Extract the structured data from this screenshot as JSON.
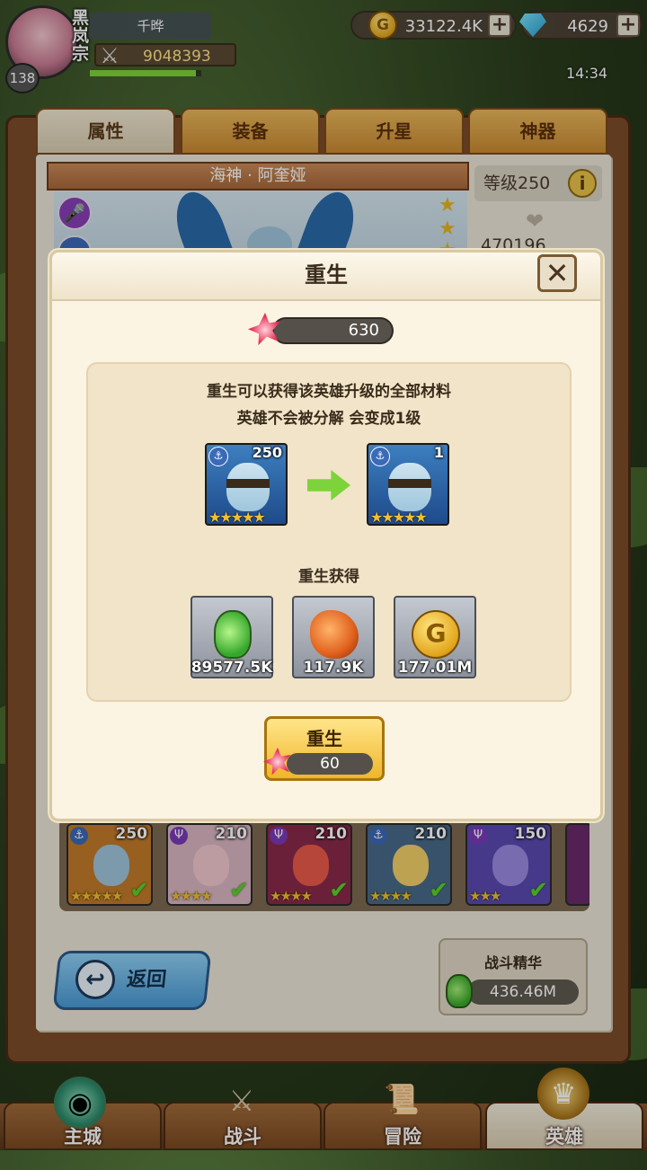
{
  "player": {
    "guild_tag": "黑岚宗",
    "name": "千晔",
    "level": "138",
    "power": "9048393",
    "exp_fraction": 0.95
  },
  "resources": {
    "gold": "33122.4K",
    "gems": "4629"
  },
  "clock": "14:34",
  "tabs": [
    "属性",
    "装备",
    "升星",
    "神器"
  ],
  "hero_panel": {
    "hero_name": "海神 · 阿奎娅",
    "level_label": "等级250",
    "hp": "470196"
  },
  "modal": {
    "title": "重生",
    "cost": "630",
    "description_line1": "重生可以获得该英雄升级的全部材料",
    "description_line2": "英雄不会被分解 会变成1级",
    "before_level": "250",
    "after_level": "1",
    "reward_title": "重生获得",
    "rewards": [
      {
        "icon": "potion-icon",
        "amount": "89577.5K"
      },
      {
        "icon": "ore-icon",
        "amount": "117.9K"
      },
      {
        "icon": "gold-coin-icon",
        "amount": "177.01M"
      }
    ],
    "button_label": "重生",
    "button_cost": "60"
  },
  "roster": [
    {
      "level": "250",
      "stars": 5,
      "class": "anchor",
      "colors": {
        "bg": "#c27a2a",
        "face": "#9fc6dc"
      }
    },
    {
      "level": "210",
      "stars": 4,
      "class": "trident",
      "colors": {
        "bg": "#d9b6c2",
        "face": "#f2c8cf"
      }
    },
    {
      "level": "210",
      "stars": 4,
      "class": "trident",
      "colors": {
        "bg": "#8a2a4a",
        "face": "#e85a4a"
      }
    },
    {
      "level": "210",
      "stars": 4,
      "class": "anchor",
      "colors": {
        "bg": "#4a6a8a",
        "face": "#f2d06a"
      }
    },
    {
      "level": "150",
      "stars": 3,
      "class": "trident",
      "colors": {
        "bg": "#5a4ab0",
        "face": "#9a8ae0"
      }
    }
  ],
  "back_button": "返回",
  "essence": {
    "title": "战斗精华",
    "value": "436.46M"
  },
  "nav": [
    "主城",
    "战斗",
    "冒险",
    "英雄"
  ],
  "colors": {
    "accent_gold": "#f0b62a",
    "check_green": "#5ad22a"
  }
}
